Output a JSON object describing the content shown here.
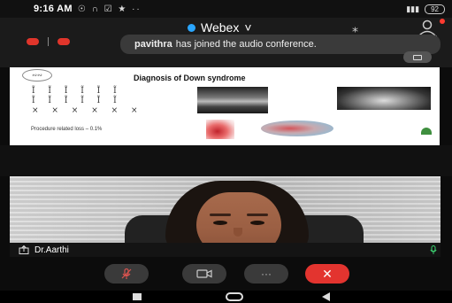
{
  "status_bar": {
    "time": "9:16 AM",
    "left_icons": "☉ ∩ ☑ ★ ··",
    "battery": "92"
  },
  "header": {
    "app_title": "Webex",
    "chevron": "˅",
    "accent_color": "#2aa6ff",
    "icons": [
      "bluetooth-icon",
      "participants-icon"
    ]
  },
  "toast": {
    "name": "pavithra",
    "message": "has joined the audio conference."
  },
  "slide": {
    "title": "Diagnosis of Down syndrome",
    "karyotype_rows": [
      "Ĩ Ĩ Ĩ Ĩ Ĩ Ĩ",
      "Ĩ Ĩ Ĩ Ĩ Ĩ Ĩ",
      "× × × × × ×"
    ],
    "procedure_text": "Procedure related loss – 0.1%"
  },
  "participant": {
    "name": "Dr.Aarthi"
  },
  "controls": {
    "end_color": "#e3342f",
    "items": [
      "mute-mic-icon",
      "video-camera-icon",
      "more-options-icon",
      "end-call-icon"
    ],
    "more_label": "···",
    "end_label": "✕"
  }
}
